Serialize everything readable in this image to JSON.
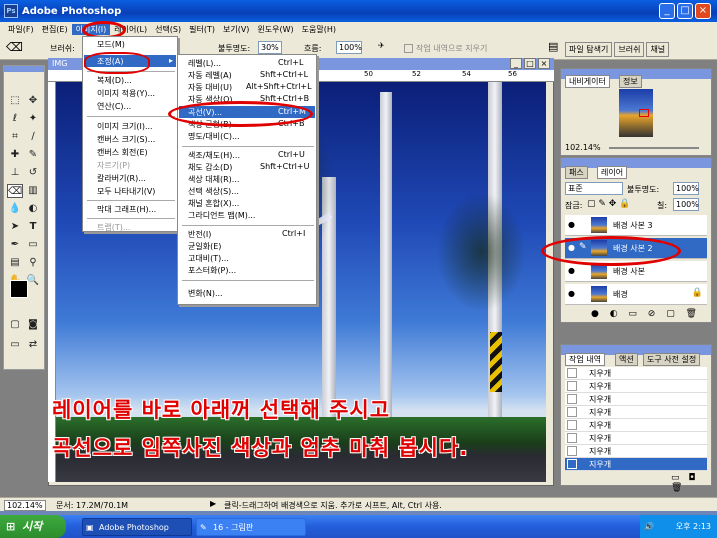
{
  "window": {
    "title": "Adobe Photoshop",
    "minimize": "_",
    "maximize": "□",
    "close": "×"
  },
  "menubar": [
    "파일(F)",
    "편집(E)",
    "이미지(I)",
    "레이어(L)",
    "선택(S)",
    "필터(T)",
    "보기(V)",
    "윈도우(W)",
    "도움말(H)"
  ],
  "options": {
    "brush_label": "브러쉬:",
    "opacity_label": "불투명도:",
    "opacity": "30%",
    "flow_label": "흐름:",
    "flow": "100%",
    "erase_history": "작업 내역으로 지우기"
  },
  "panel_tabs": [
    "파일 탐색기",
    "브러쉬",
    "채널"
  ],
  "doc": {
    "title": "IMG",
    "ruler": [
      "50",
      "52",
      "54",
      "56",
      "58",
      "60"
    ]
  },
  "image_menu": {
    "items": [
      "모드(M)",
      "조정(A)",
      "복제(D)...",
      "이미지 적용(Y)...",
      "연산(C)...",
      "이미지 크기(I)...",
      "캔버스 크기(S)...",
      "캔버스 회전(E)",
      "자르기(P)",
      "칼라버기(R)...",
      "모두 나타내기(V)",
      "막대 그래프(H)...",
      "트랩(T)..."
    ]
  },
  "adjust_menu": {
    "items": [
      "레벨(L)...",
      "자동 레벨(A)",
      "자동 대비(U)",
      "자동 색상(O)",
      "곡선(V)...",
      "색상 균형(B)...",
      "명도/대비(C)...",
      "색조/채도(H)...",
      "채도 감소(D)",
      "색상 대체(R)...",
      "선택 색상(S)...",
      "채널 혼합(X)...",
      "그라디언트 맵(M)...",
      "반전(I)",
      "균일화(E)",
      "고대비(T)...",
      "포스터화(P)...",
      "변화(N)..."
    ],
    "shortcuts": [
      "Ctrl+L",
      "Shft+Ctrl+L",
      "Alt+Shft+Ctrl+L",
      "Shft+Ctrl+B",
      "Ctrl+M",
      "Ctrl+B",
      "",
      "Ctrl+U",
      "Shft+Ctrl+U",
      "",
      "",
      "",
      "",
      "Ctrl+I",
      "",
      "",
      "",
      ""
    ]
  },
  "caption": {
    "line1": "레이어를 바로 아래꺼 선택해 주시고",
    "line2": "곡선으로 임쪽사진 색상과 엄추 마춰 봅시다."
  },
  "navigator": {
    "tabs": [
      "내비게이터",
      "정보"
    ],
    "zoom": "102.14%"
  },
  "layers_panel": {
    "tabs": [
      "패스",
      "레이어"
    ],
    "mode": "표준",
    "opacity_label": "불투명도:",
    "opacity": "100%",
    "lock_label": "잠금:",
    "fill_label": "칠:",
    "fill": "100%",
    "layers": [
      "배경 사본 3",
      "배경 사본 2",
      "배경 사본",
      "배경"
    ]
  },
  "history_panel": {
    "tabs": [
      "작업 내역",
      "액션",
      "도구 사전 설정"
    ],
    "items": [
      "지우개",
      "지우개",
      "지우개",
      "지우개",
      "지우개",
      "지우개",
      "지우개",
      "지우개"
    ]
  },
  "status": {
    "zoom": "102.14%",
    "doc": "문서: 17.2M/70.1M",
    "hint": "클릭-드래그하여 배경색으로 지움. 추가로 시프트, Alt, Ctrl 사용."
  },
  "taskbar": {
    "start": "시작",
    "tasks": [
      "Adobe Photoshop",
      "16 - 그림판"
    ],
    "clock": "오후 2:13"
  },
  "colors": {
    "titlebar": "#0a5fe0",
    "highlight": "#316ac5",
    "annotation_red": "#e00000"
  }
}
